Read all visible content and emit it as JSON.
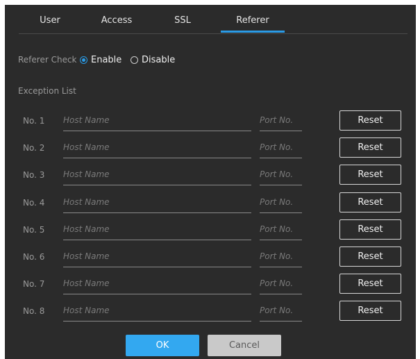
{
  "tabs": [
    {
      "label": "User",
      "active": false
    },
    {
      "label": "Access",
      "active": false
    },
    {
      "label": "SSL",
      "active": false
    },
    {
      "label": "Referer",
      "active": true
    }
  ],
  "referer_check": {
    "label": "Referer Check",
    "options": [
      {
        "label": "Enable",
        "selected": true
      },
      {
        "label": "Disable",
        "selected": false
      }
    ]
  },
  "exception_list": {
    "label": "Exception List",
    "rows": [
      {
        "num": "No. 1",
        "host_placeholder": "Host Name",
        "port_placeholder": "Port No.",
        "reset": "Reset"
      },
      {
        "num": "No. 2",
        "host_placeholder": "Host Name",
        "port_placeholder": "Port No.",
        "reset": "Reset"
      },
      {
        "num": "No. 3",
        "host_placeholder": "Host Name",
        "port_placeholder": "Port No.",
        "reset": "Reset"
      },
      {
        "num": "No. 4",
        "host_placeholder": "Host Name",
        "port_placeholder": "Port No.",
        "reset": "Reset"
      },
      {
        "num": "No. 5",
        "host_placeholder": "Host Name",
        "port_placeholder": "Port No.",
        "reset": "Reset"
      },
      {
        "num": "No. 6",
        "host_placeholder": "Host Name",
        "port_placeholder": "Port No.",
        "reset": "Reset"
      },
      {
        "num": "No. 7",
        "host_placeholder": "Host Name",
        "port_placeholder": "Port No.",
        "reset": "Reset"
      },
      {
        "num": "No. 8",
        "host_placeholder": "Host Name",
        "port_placeholder": "Port No.",
        "reset": "Reset"
      }
    ]
  },
  "footer": {
    "ok_label": "OK",
    "cancel_label": "Cancel"
  },
  "colors": {
    "accent": "#2b9be6",
    "panel_bg": "#2b2b2b",
    "ok_bg": "#33a8f0",
    "cancel_bg": "#c9c9c9"
  }
}
